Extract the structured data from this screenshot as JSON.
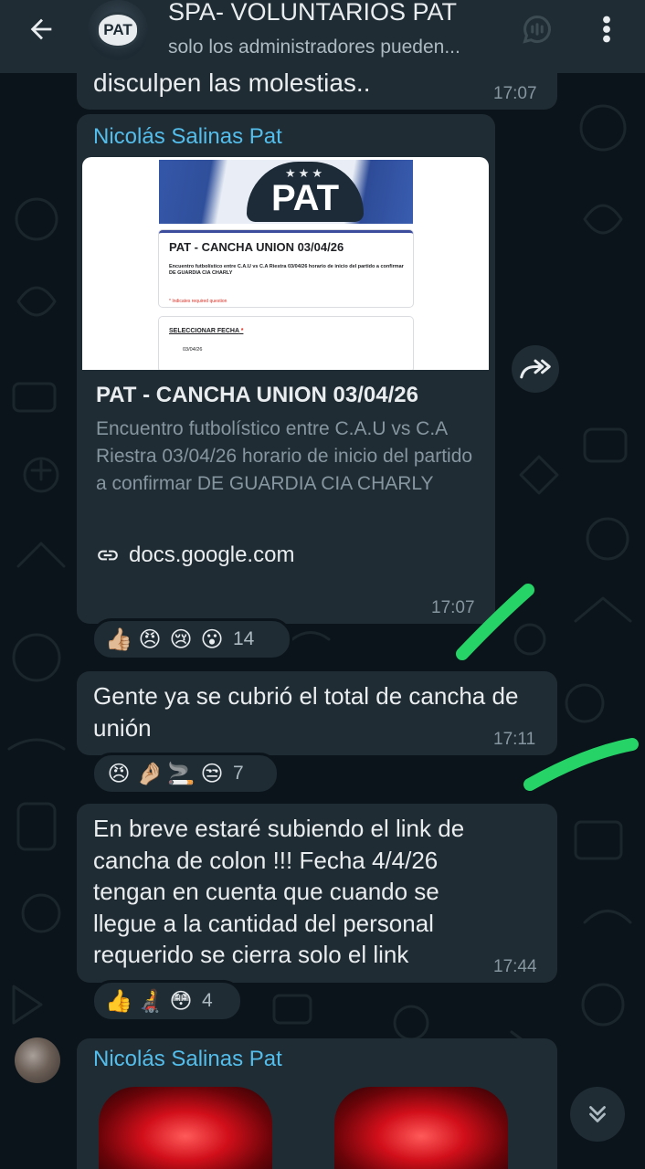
{
  "header": {
    "title": "SPA- VOLUNTARIOS PAT",
    "subtitle": "solo los administradores pueden...",
    "avatar_text": "PAT"
  },
  "messages": [
    {
      "text": "disculpen las molestias..",
      "time": "17:07"
    },
    {
      "sender": "Nicolás Salinas Pat",
      "link_preview": {
        "thumb": {
          "stars": "★★★",
          "logo": "PAT",
          "form_title": "PAT - CANCHA UNION   03/04/26",
          "form_desc": "Encuentro futbolístico entre C.A.U  vs C.A Riestra   03/04/26 horario de inicio del partido a confirmar DE GUARDIA CIA CHARLY",
          "required_note": "* Indicates required question",
          "field_label": "SELECCIONAR FECHA",
          "field_required": " *",
          "field_value": "03/04/26"
        },
        "title": "PAT - CANCHA UNION 03/04/26",
        "description": "Encuentro futbolístico entre C.A.U vs C.A Riestra 03/04/26 horario de inicio del partido a confirmar DE GUARDIA CIA CHARLY",
        "domain": "docs.google.com"
      },
      "time": "17:07",
      "reactions": {
        "emojis": [
          "👍🏼",
          "😠",
          "😢",
          "😮"
        ],
        "count": "14"
      }
    },
    {
      "text": "Gente ya se  cubrió el total de cancha de unión",
      "time": "17:11",
      "reactions": {
        "emojis": [
          "😠",
          "🤌🏼",
          "🚬",
          "😒"
        ],
        "count": "7"
      }
    },
    {
      "text": "En breve estaré subiendo el link de cancha de colon !!! Fecha 4/4/26 tengan en cuenta que cuando se llegue a la cantidad del personal requerido se cierra solo el link",
      "time": "17:44",
      "reactions": {
        "emojis": [
          "👍",
          "🧑‍🦼",
          "😳"
        ],
        "count": "4"
      }
    },
    {
      "sender": "Nicolás Salinas Pat"
    }
  ],
  "colors": {
    "background": "#0b141a",
    "bubble": "#202c33",
    "header": "#1f2c34",
    "sender_name": "#53bdeb",
    "timestamp": "#8696a0",
    "highlight_stroke": "#25d366"
  },
  "icons": {
    "back": "arrow-left-icon",
    "call": "call-add-icon",
    "menu": "more-vertical-icon",
    "forward": "forward-icon",
    "link": "link-icon",
    "scroll": "double-chevron-down-icon"
  }
}
